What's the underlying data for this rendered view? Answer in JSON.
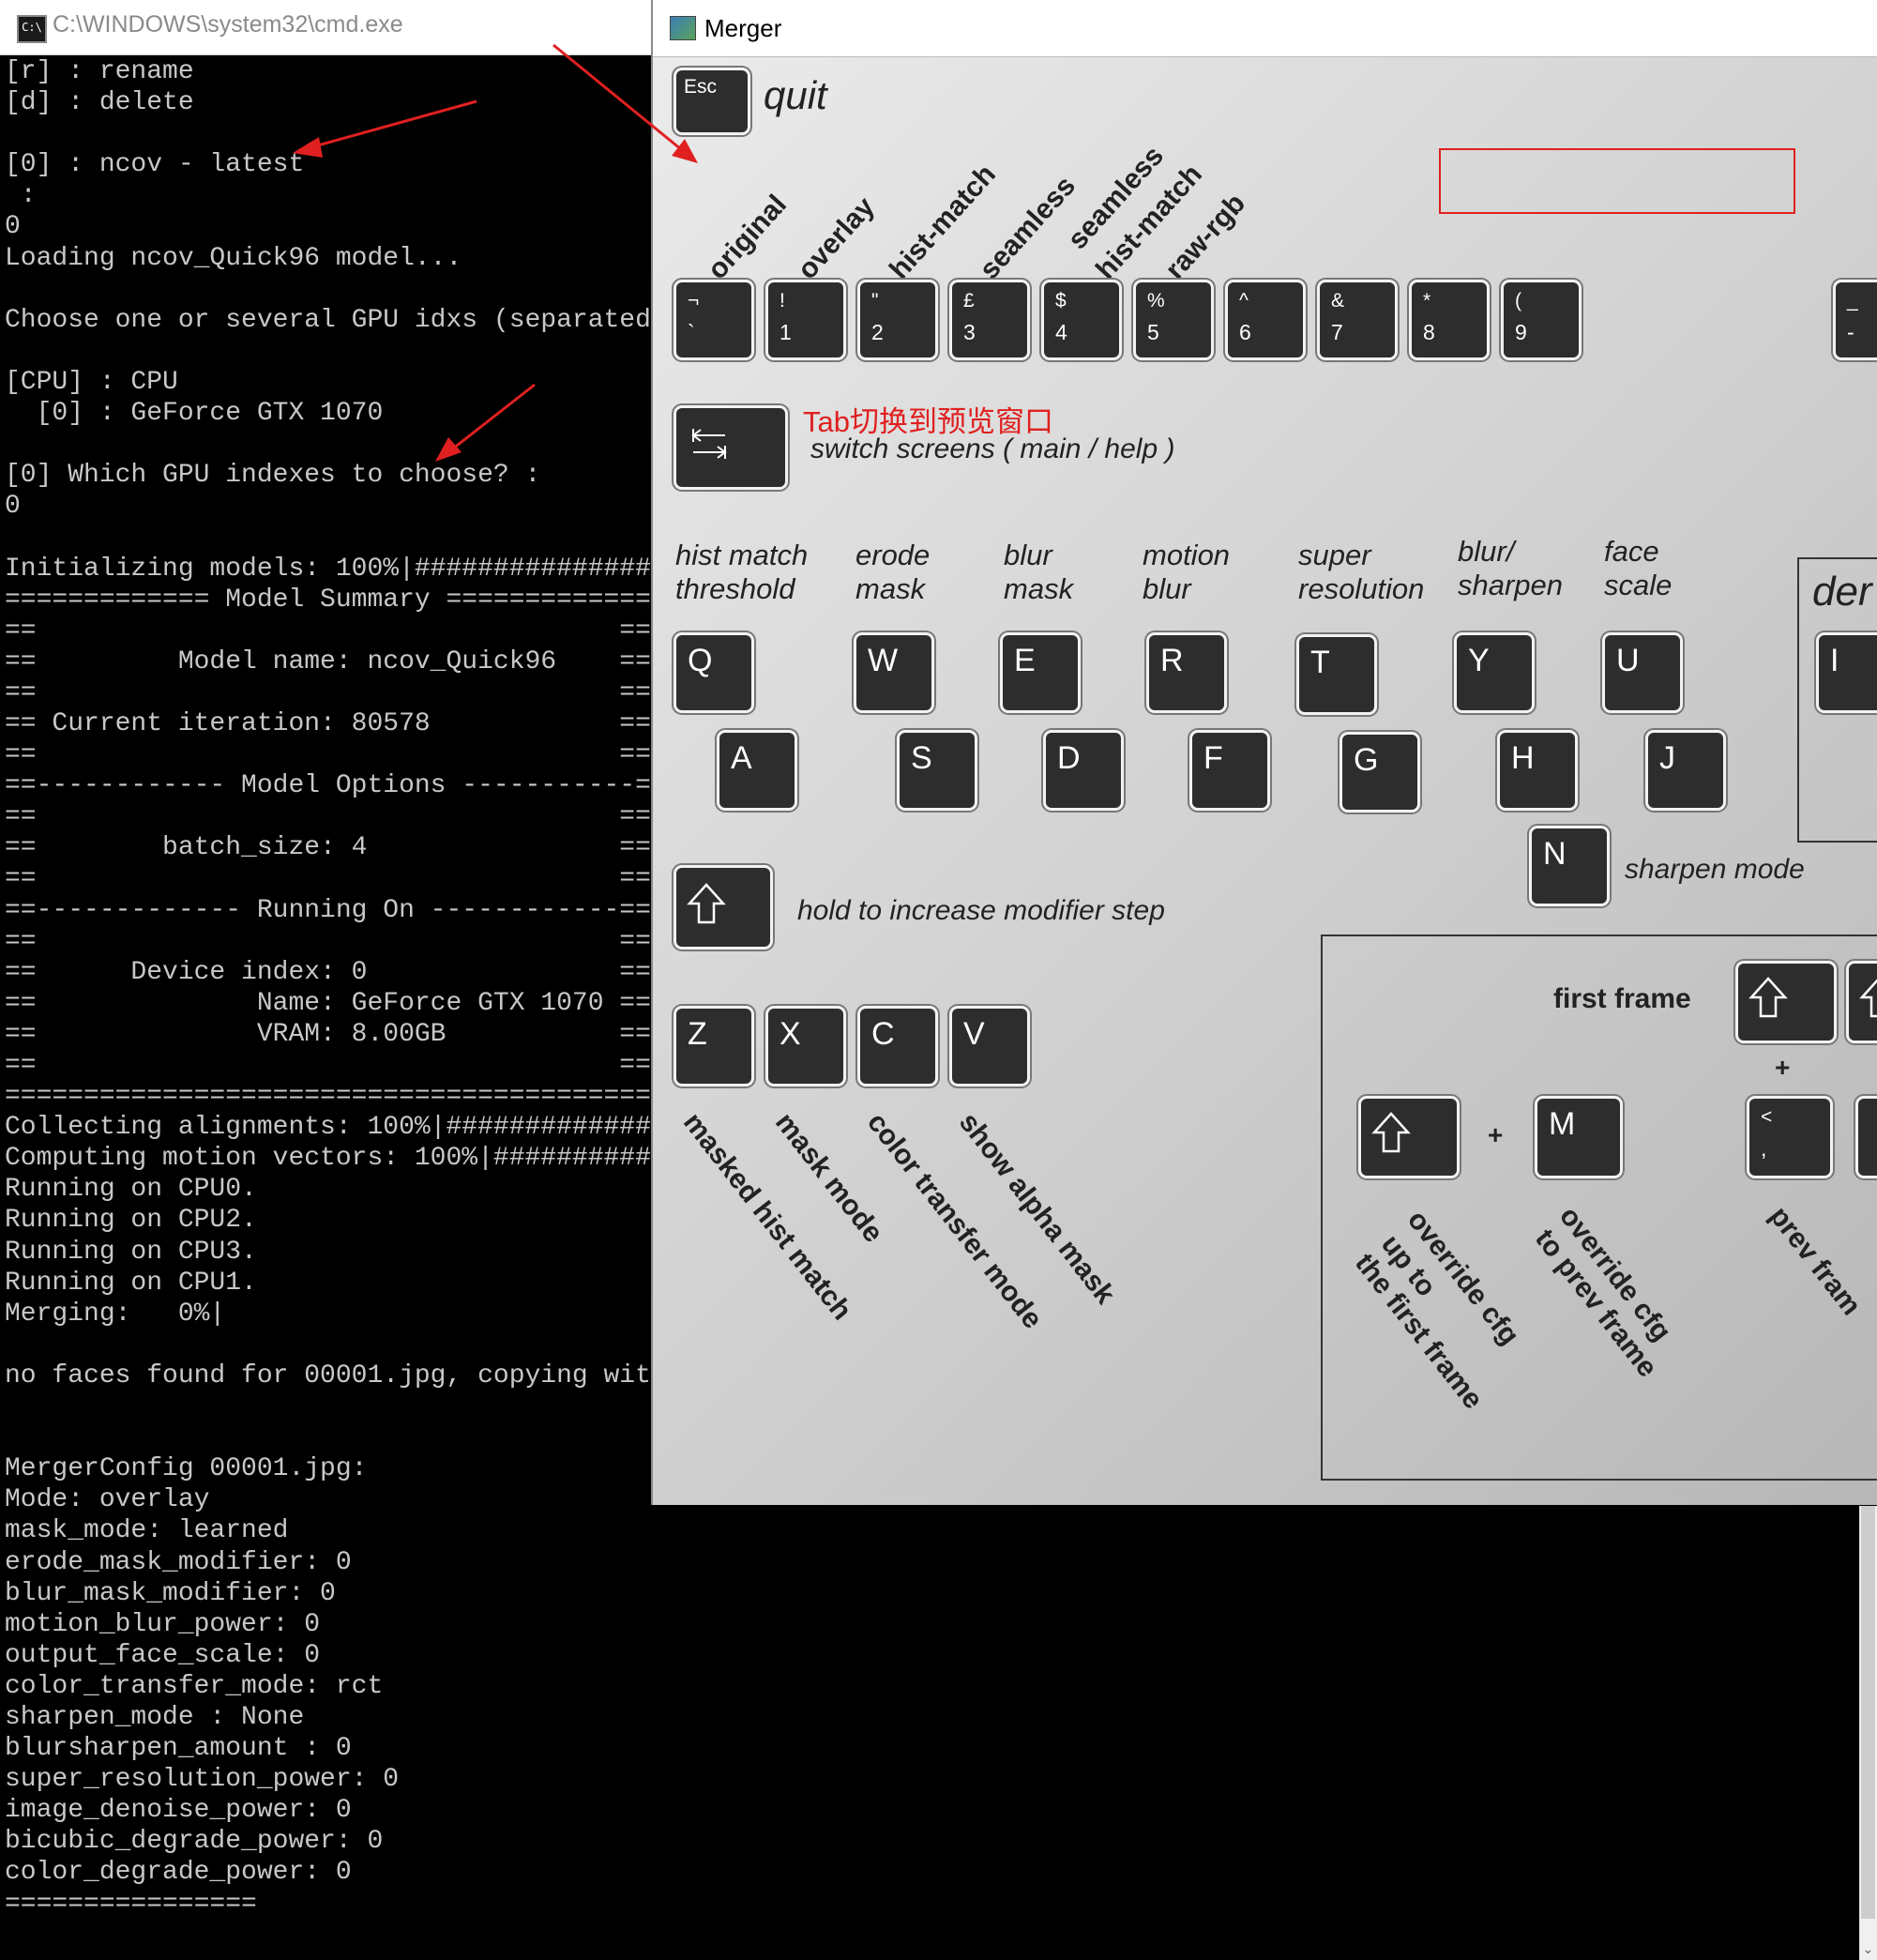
{
  "cmd": {
    "title": "C:\\WINDOWS\\system32\\cmd.exe",
    "icon": "console-icon",
    "console_text": "[r] : rename\n[d] : delete\n\n[0] : ncov - latest\n :\n0\nLoading ncov_Quick96 model...\n\nChoose one or several GPU idxs (separated b\n\n[CPU] : CPU\n  [0] : GeForce GTX 1070\n\n[0] Which GPU indexes to choose? :\n0\n\nInitializing models: 100%|##################\n============= Model Summary =============\n==                                     ==\n==         Model name: ncov_Quick96    ==\n==                                     ==\n== Current iteration: 80578            ==\n==                                     ==\n==------------ Model Options -----------==\n==                                     ==\n==        batch_size: 4                ==\n==                                     ==\n==------------- Running On ------------==\n==                                     ==\n==      Device index: 0                ==\n==              Name: GeForce GTX 1070 ==\n==              VRAM: 8.00GB           ==\n==                                     ==\n=========================================\nCollecting alignments: 100%|################\nComputing motion vectors: 100%|#############\nRunning on CPU0.\nRunning on CPU2.\nRunning on CPU3.\nRunning on CPU1.\nMerging:   0%|\n\nno faces found for 00001.jpg, copying witho\n\n\nMergerConfig 00001.jpg:\nMode: overlay\nmask_mode: learned\nerode_mask_modifier: 0\nblur_mask_modifier: 0\nmotion_blur_power: 0\noutput_face_scale: 0\ncolor_transfer_mode: rct\nsharpen_mode : None\nblursharpen_amount : 0\nsuper_resolution_power: 0\nimage_denoise_power: 0\nbicubic_degrade_power: 0\ncolor_degrade_power: 0\n================"
  },
  "merger": {
    "title": "Merger",
    "esc": {
      "key": "Esc",
      "label": "quit"
    },
    "mode_labels": [
      "original",
      "overlay",
      "hist-match",
      "seamless",
      "seamless",
      "hist-match",
      "raw-rgb"
    ],
    "number_keys": [
      {
        "top": "¬",
        "bottom": "`"
      },
      {
        "top": "!",
        "bottom": "1"
      },
      {
        "top": "\"",
        "bottom": "2"
      },
      {
        "top": "£",
        "bottom": "3"
      },
      {
        "top": "$",
        "bottom": "4"
      },
      {
        "top": "%",
        "bottom": "5"
      },
      {
        "top": "^",
        "bottom": "6"
      },
      {
        "top": "&",
        "bottom": "7"
      },
      {
        "top": "*",
        "bottom": "8"
      },
      {
        "top": "(",
        "bottom": "9"
      },
      {
        "top": "_",
        "bottom": "-"
      }
    ],
    "tab": {
      "annotation": "Tab切换到预览窗口",
      "label": "switch screens ( main / help )"
    },
    "param_labels": [
      {
        "line1": "hist match",
        "line2": "threshold"
      },
      {
        "line1": "erode",
        "line2": "mask"
      },
      {
        "line1": "blur",
        "line2": "mask"
      },
      {
        "line1": "motion",
        "line2": "blur"
      },
      {
        "line1": "super",
        "line2": "resolution"
      },
      {
        "line1": "blur/",
        "line2": "sharpen"
      },
      {
        "line1": "face",
        "line2": "scale"
      }
    ],
    "den_label": "der",
    "qrow": [
      "Q",
      "W",
      "E",
      "R",
      "T",
      "Y",
      "U",
      "I"
    ],
    "arow": [
      "A",
      "S",
      "D",
      "F",
      "G",
      "H",
      "J"
    ],
    "n_key": {
      "key": "N",
      "label": "sharpen mode"
    },
    "shift_hold_label": "hold to increase modifier step",
    "zrow": [
      "Z",
      "X",
      "C",
      "V"
    ],
    "zrow_labels": [
      "masked hist match",
      "mask mode",
      "color transfer mode",
      "show alpha mask"
    ],
    "first_frame_label": "first frame",
    "plus": "+",
    "m_key": "M",
    "comma_key": {
      "top": "<",
      "bottom": ","
    },
    "override_labels": [
      {
        "line1": "override cfg",
        "line2": "up to",
        "line3": "the first frame"
      },
      {
        "line1": "override cfg",
        "line2": "to prev frame"
      }
    ],
    "prev_frame_label": "prev fram"
  },
  "colors": {
    "annotation_red": "#e02020",
    "key_face": "#2d2d2d",
    "console_text": "#c8c8c8"
  }
}
